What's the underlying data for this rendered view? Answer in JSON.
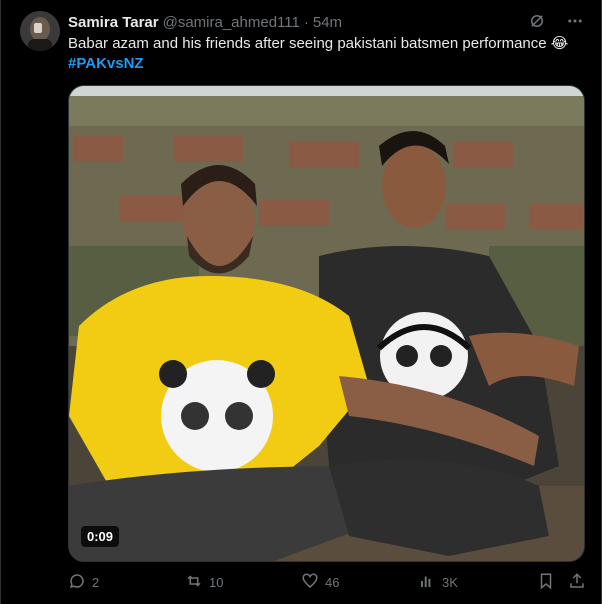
{
  "tweet": {
    "display_name": "Samira Tarar",
    "handle": "@samira_ahmed111",
    "separator": "·",
    "time": "54m",
    "text": "Babar azam and his friends after seeing pakistani batsmen performance 😂",
    "hashtag": "#PAKvsNZ",
    "video_duration": "0:09"
  },
  "actions": {
    "replies": "2",
    "reposts": "10",
    "likes": "46",
    "views": "3K"
  },
  "colors": {
    "background": "#000000",
    "text": "#e7e9ea",
    "muted": "#71767b",
    "link": "#1d9bf0"
  },
  "icons": {
    "header": [
      "grok-icon",
      "more-icon"
    ],
    "actions": [
      "reply-icon",
      "repost-icon",
      "like-icon",
      "views-icon",
      "bookmark-icon",
      "share-icon"
    ]
  }
}
